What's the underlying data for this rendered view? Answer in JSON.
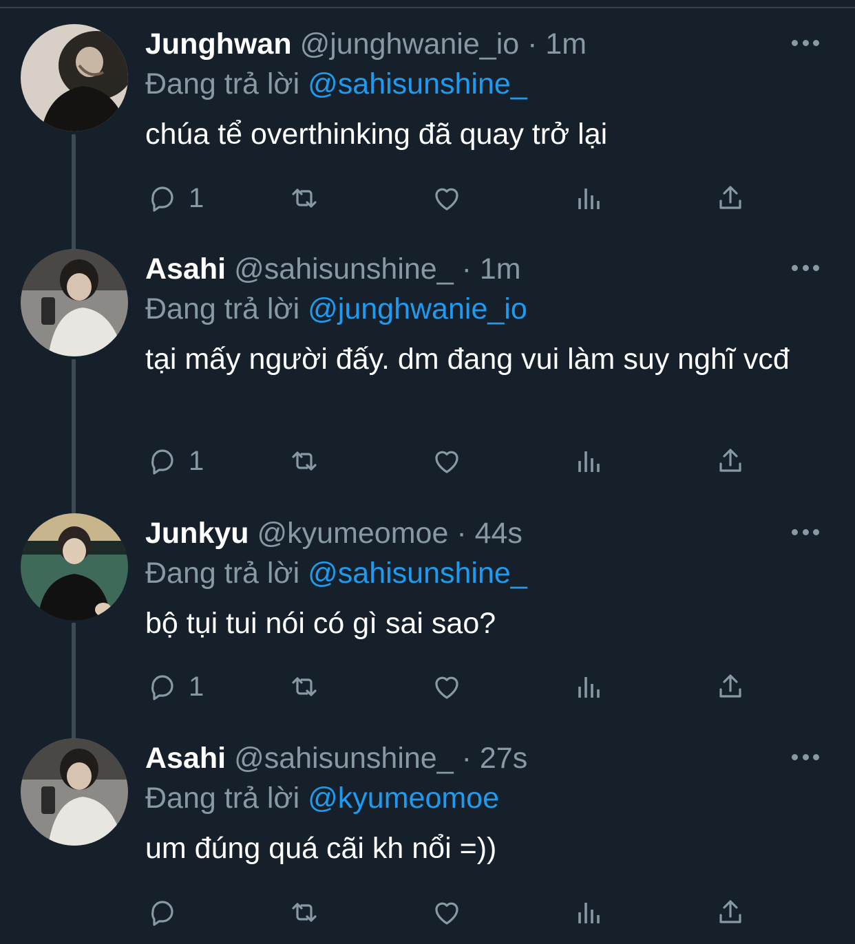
{
  "reply_prefix": "Đang trả lời",
  "colors": {
    "background": "#15202b",
    "accent": "#1d9bf0",
    "muted": "#8899a6"
  },
  "tweets": [
    {
      "name": "Junghwan",
      "handle": "@junghwanie_io",
      "time": "· 1m",
      "replying_to": "@sahisunshine_",
      "text": "chúa tể overthinking đã quay trở lại",
      "reply_count": "1"
    },
    {
      "name": "Asahi",
      "handle": "@sahisunshine_",
      "time": "· 1m",
      "replying_to": "@junghwanie_io",
      "text": "tại mấy người đấy. dm đang vui làm suy nghĩ vcđ",
      "reply_count": "1"
    },
    {
      "name": "Junkyu",
      "handle": "@kyumeomoe",
      "time": "· 44s",
      "replying_to": "@sahisunshine_",
      "text": "bộ tụi tui nói có gì sai sao?",
      "reply_count": "1"
    },
    {
      "name": "Asahi",
      "handle": "@sahisunshine_",
      "time": "· 27s",
      "replying_to": "@kyumeomoe",
      "text": "um đúng quá cãi kh nổi =))",
      "reply_count": ""
    }
  ]
}
